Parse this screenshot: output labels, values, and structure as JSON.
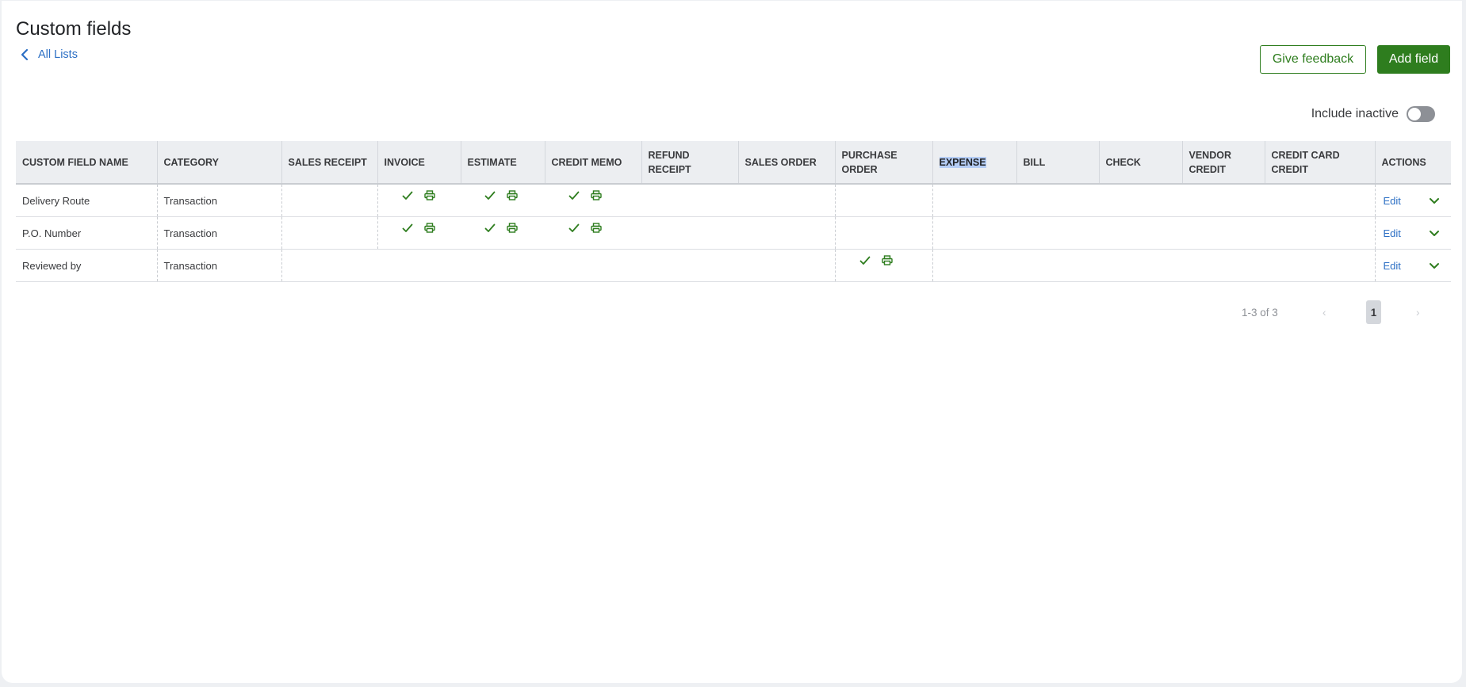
{
  "header": {
    "title": "Custom fields",
    "back_label": "All Lists",
    "feedback_label": "Give feedback",
    "add_label": "Add field"
  },
  "filters": {
    "include_inactive_label": "Include inactive",
    "include_inactive_on": false
  },
  "table": {
    "columns": [
      "CUSTOM FIELD NAME",
      "CATEGORY",
      "SALES RECEIPT",
      "INVOICE",
      "ESTIMATE",
      "CREDIT MEMO",
      "REFUND RECEIPT",
      "SALES ORDER",
      "PURCHASE ORDER",
      "EXPENSE",
      "BILL",
      "CHECK",
      "VENDOR CREDIT",
      "CREDIT CARD CREDIT",
      "ACTIONS"
    ],
    "rows": [
      {
        "name": "Delivery Route",
        "category": "Transaction",
        "edit_label": "Edit"
      },
      {
        "name": "P.O. Number",
        "category": "Transaction",
        "edit_label": "Edit"
      },
      {
        "name": "Reviewed by",
        "category": "Transaction",
        "edit_label": "Edit"
      }
    ]
  },
  "pagination": {
    "range_label": "1-3 of 3",
    "current_page": "1",
    "prev_glyph": "‹",
    "next_glyph": "›"
  },
  "colors": {
    "brand_green": "#2e7d1e",
    "link_blue": "#2c6fc4",
    "selection_highlight": "#b5cdf5"
  },
  "icons": {
    "back": "chevron-left-icon",
    "enabled": "checkmark-icon",
    "printable": "printer-icon",
    "expand": "chevron-down-icon"
  }
}
